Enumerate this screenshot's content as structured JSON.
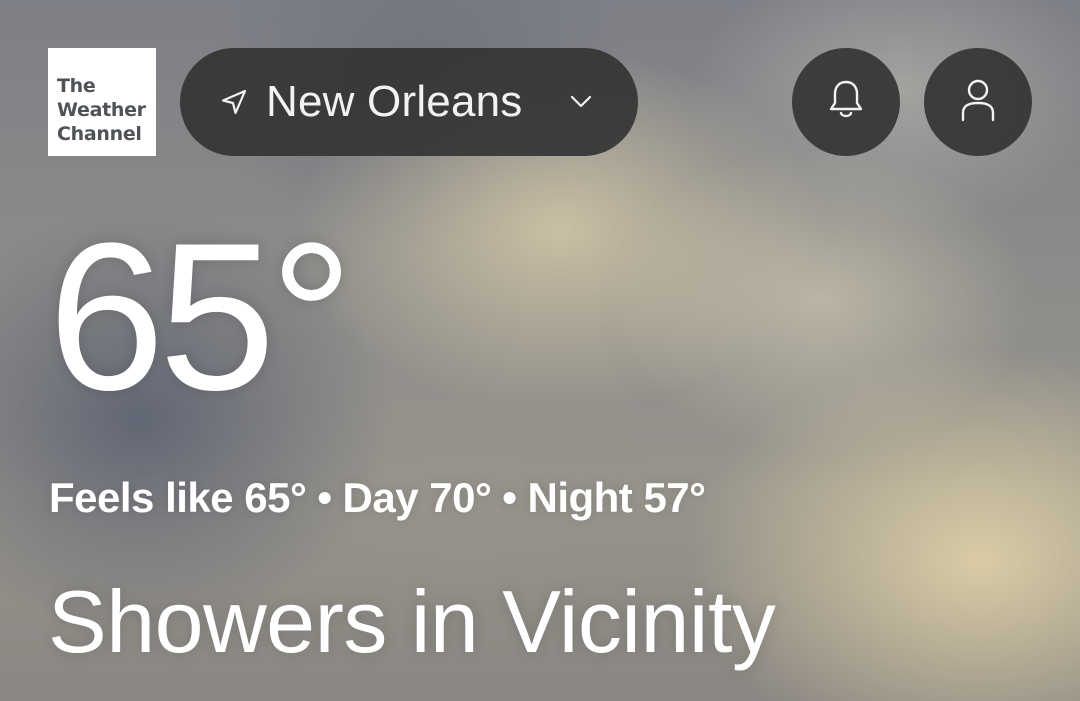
{
  "brand": {
    "logo_line1": "The",
    "logo_line2": "Weather",
    "logo_line3": "Channel"
  },
  "header": {
    "location": "New Orleans",
    "icons": {
      "location": "location-arrow-icon",
      "dropdown": "chevron-down-icon",
      "notifications": "bell-icon",
      "profile": "user-icon"
    }
  },
  "current": {
    "temperature": "65°",
    "feels_like": "Feels like 65°",
    "day": "Day 70°",
    "night": "Night 57°",
    "separator": "•",
    "condition": "Showers in Vicinity"
  },
  "colors": {
    "pill_background": "#343434",
    "logo_text": "#4f5257",
    "text": "#ffffff"
  }
}
